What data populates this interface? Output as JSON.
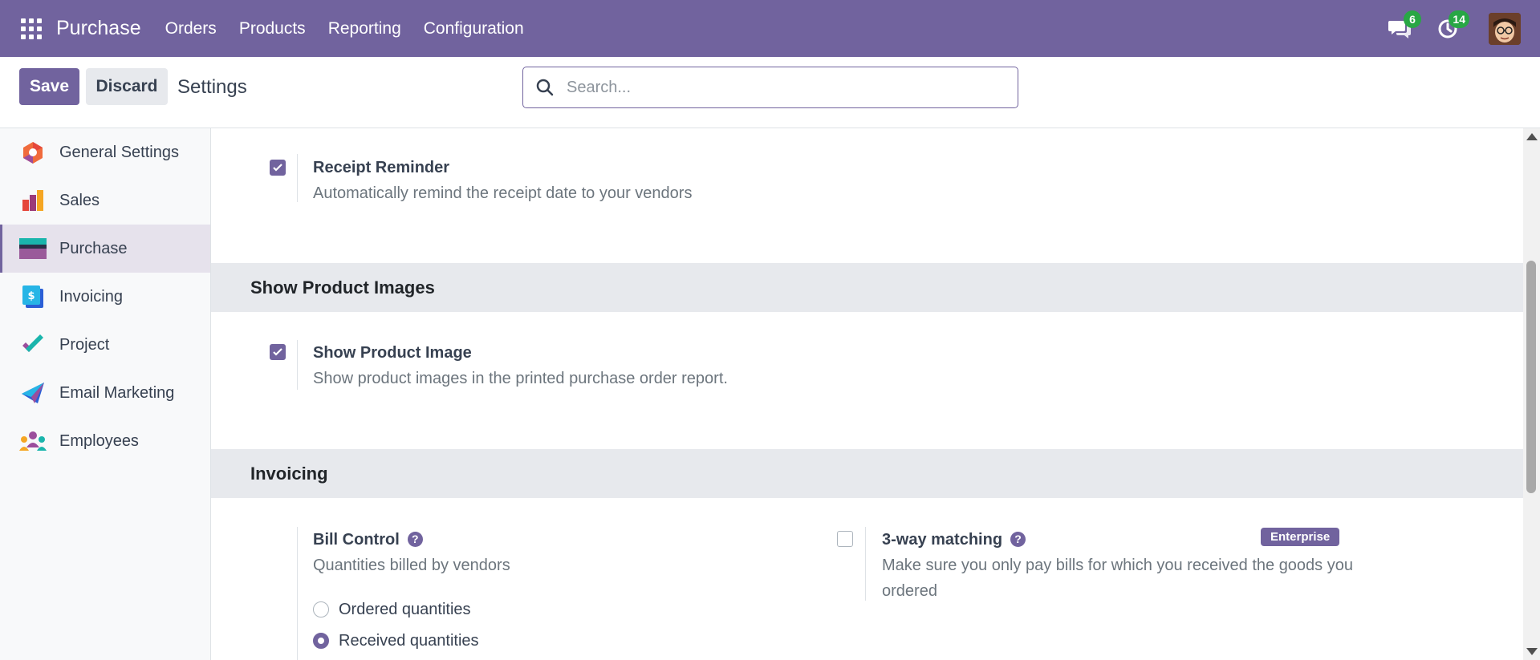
{
  "navbar": {
    "brand": "Purchase",
    "menu": [
      "Orders",
      "Products",
      "Reporting",
      "Configuration"
    ],
    "messages_count": "6",
    "activities_count": "14"
  },
  "control": {
    "save_label": "Save",
    "discard_label": "Discard",
    "title": "Settings",
    "search_placeholder": "Search..."
  },
  "sidebar": {
    "items": [
      {
        "label": "General Settings",
        "icon": "general-settings-icon"
      },
      {
        "label": "Sales",
        "icon": "sales-icon"
      },
      {
        "label": "Purchase",
        "icon": "purchase-icon",
        "active": true
      },
      {
        "label": "Invoicing",
        "icon": "invoicing-icon"
      },
      {
        "label": "Project",
        "icon": "project-icon"
      },
      {
        "label": "Email Marketing",
        "icon": "email-marketing-icon"
      },
      {
        "label": "Employees",
        "icon": "employees-icon"
      }
    ]
  },
  "content": {
    "receipt_reminder": {
      "title": "Receipt Reminder",
      "description": "Automatically remind the receipt date to your vendors",
      "checked": true
    },
    "product_images_section": "Show Product Images",
    "show_product_image": {
      "title": "Show Product Image",
      "description": "Show product images in the printed purchase order report.",
      "checked": true
    },
    "invoicing_section": "Invoicing",
    "bill_control": {
      "title": "Bill Control",
      "description": "Quantities billed by vendors",
      "options": [
        "Ordered quantities",
        "Received quantities"
      ],
      "selected": "Received quantities"
    },
    "three_way_matching": {
      "title": "3-way matching",
      "description": "Make sure you only pay bills for which you received the goods you ordered",
      "badge": "Enterprise",
      "checked": false
    }
  },
  "colors": {
    "brand": "#71639e",
    "badge": "#28a745"
  }
}
